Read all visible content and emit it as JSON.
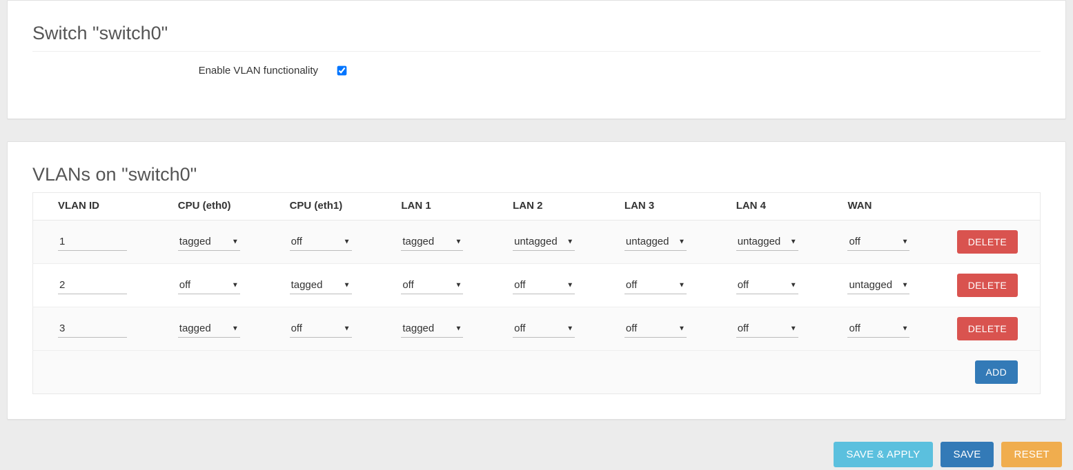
{
  "panel1": {
    "title": "Switch \"switch0\"",
    "enable_label": "Enable VLAN functionality",
    "enable_checked": true
  },
  "panel2": {
    "title": "VLANs on \"switch0\"",
    "headers": [
      "VLAN ID",
      "CPU (eth0)",
      "CPU (eth1)",
      "LAN 1",
      "LAN 2",
      "LAN 3",
      "LAN 4",
      "WAN"
    ],
    "rows": [
      {
        "id": "1",
        "ports": [
          "tagged",
          "off",
          "tagged",
          "untagged",
          "untagged",
          "untagged",
          "off"
        ]
      },
      {
        "id": "2",
        "ports": [
          "off",
          "tagged",
          "off",
          "off",
          "off",
          "off",
          "untagged"
        ]
      },
      {
        "id": "3",
        "ports": [
          "tagged",
          "off",
          "tagged",
          "off",
          "off",
          "off",
          "off"
        ]
      }
    ],
    "delete_label": "DELETE",
    "add_label": "ADD"
  },
  "actions": {
    "save_apply": "SAVE & APPLY",
    "save": "SAVE",
    "reset": "RESET"
  }
}
